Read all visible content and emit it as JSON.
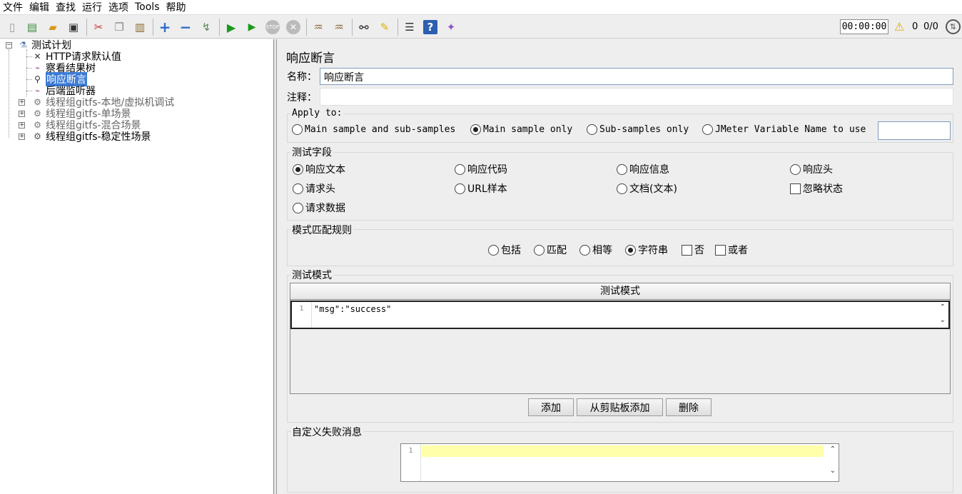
{
  "menu": [
    "文件",
    "编辑",
    "查找",
    "运行",
    "选项",
    "Tools",
    "帮助"
  ],
  "toolbar": {
    "timer": "00:00:00",
    "warning_count": "0",
    "threads": "0/0"
  },
  "tree": {
    "root": "测试计划",
    "children": [
      "HTTP请求默认值",
      "察看结果树",
      "响应断言",
      "后端监听器"
    ],
    "thread_groups": [
      "线程组gitfs-本地/虚拟机调试",
      "线程组gitfs-单场景",
      "线程组gitfs-混合场景",
      "线程组gitfs-稳定性场景"
    ]
  },
  "panel": {
    "title": "响应断言",
    "name_label": "名称：",
    "name_value": "响应断言",
    "comment_label": "注释：",
    "comment_value": "",
    "apply_to": {
      "title": "Apply to:",
      "options": [
        "Main sample and sub-samples",
        "Main sample only",
        "Sub-samples only",
        "JMeter Variable Name to use"
      ],
      "selected": "Main sample only",
      "variable_value": ""
    },
    "test_field": {
      "title": "测试字段",
      "options": [
        "响应文本",
        "响应代码",
        "响应信息",
        "响应头",
        "请求头",
        "URL样本",
        "文档(文本)",
        "忽略状态",
        "请求数据"
      ],
      "selected": "响应文本"
    },
    "pattern_rules": {
      "title": "模式匹配规则",
      "options": [
        "包括",
        "匹配",
        "相等",
        "字符串",
        "否",
        "或者"
      ],
      "selected": "字符串"
    },
    "patterns": {
      "title": "测试模式",
      "column_header": "测试模式",
      "line_number": "1",
      "value": "\"msg\":\"success\"",
      "add_button": "添加",
      "add_clipboard_button": "从剪贴板添加",
      "delete_button": "删除"
    },
    "custom_message": {
      "title": "自定义失败消息",
      "line_number": "1",
      "value": ""
    }
  }
}
